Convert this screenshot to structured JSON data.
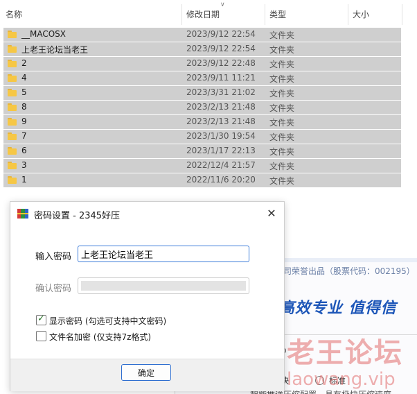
{
  "explorer": {
    "columns": {
      "name": "名称",
      "modified": "修改日期",
      "type": "类型",
      "size": "大小"
    },
    "sort_indicator": "chevron-down",
    "rows": [
      {
        "name": "__MACOSX",
        "date": "2023/9/12 22:54",
        "type": "文件夹"
      },
      {
        "name": "上老王论坛当老王",
        "date": "2023/9/12 22:54",
        "type": "文件夹"
      },
      {
        "name": "2",
        "date": "2023/9/12 22:48",
        "type": "文件夹"
      },
      {
        "name": "4",
        "date": "2023/9/11 11:21",
        "type": "文件夹"
      },
      {
        "name": "5",
        "date": "2023/3/31 21:02",
        "type": "文件夹"
      },
      {
        "name": "8",
        "date": "2023/2/13 21:48",
        "type": "文件夹"
      },
      {
        "name": "9",
        "date": "2023/2/13 21:48",
        "type": "文件夹"
      },
      {
        "name": "7",
        "date": "2023/1/30 19:54",
        "type": "文件夹"
      },
      {
        "name": "6",
        "date": "2023/1/17 22:13",
        "type": "文件夹"
      },
      {
        "name": "3",
        "date": "2022/12/4 21:57",
        "type": "文件夹"
      },
      {
        "name": "1",
        "date": "2022/11/6 20:20",
        "type": "文件夹"
      }
    ]
  },
  "dialog": {
    "title": "密码设置 - 2345好压",
    "close_icon": "close-icon",
    "password_label": "输入密码",
    "password_value": "上老王论坛当老王",
    "confirm_label": "确认密码",
    "show_password_label": "显示密码 (勾选可支持中文密码)",
    "show_password_checked": true,
    "encrypt_filename_label": "文件名加密 (仅支持7z格式)",
    "encrypt_filename_checked": false,
    "ok_label": "确定"
  },
  "background_app": {
    "company_text": "司荣誉出品（股票代码：002195）",
    "slogan": "高效专业  值得信",
    "p_text": "p",
    "fast_label": "快",
    "standard_label": "标准",
    "footer_text": "智能推送压缩配置，具有极快压缩速度"
  },
  "watermark": {
    "text_cn": "老王论坛",
    "text_url": "laowang.vip"
  },
  "colors": {
    "row_selected": "#cfcfcf",
    "folder": "#f6c745",
    "accent_blue": "#3a7ad9",
    "slogan_blue": "#1d56b8",
    "watermark": "#e26e6e"
  }
}
